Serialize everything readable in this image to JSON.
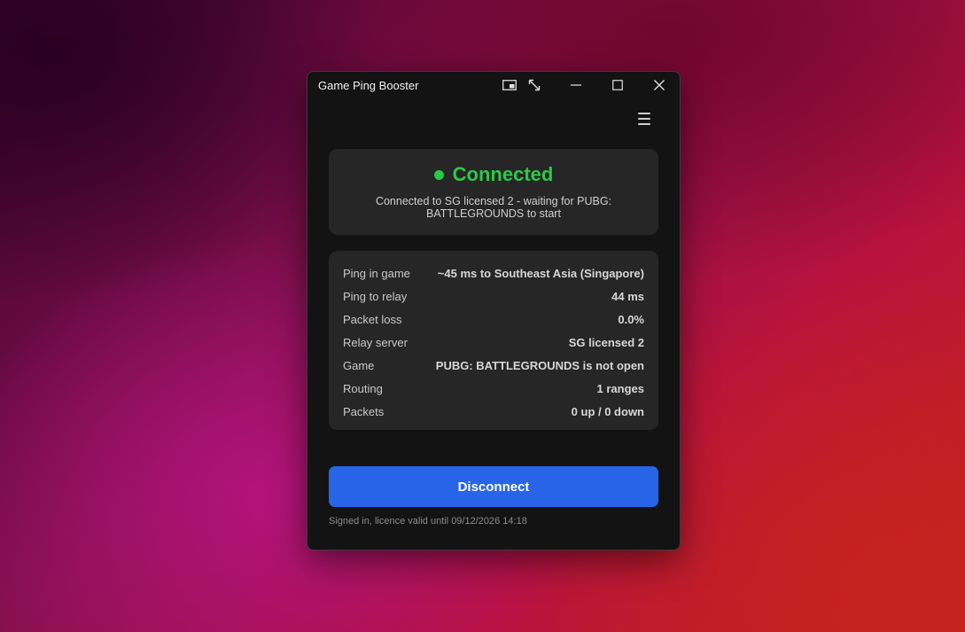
{
  "window": {
    "title": "Game Ping Booster"
  },
  "titlebar_icons": [
    "picture-in-picture-icon",
    "expand-icon",
    "minimize-icon",
    "maximize-icon",
    "close-icon"
  ],
  "status": {
    "title": "Connected",
    "subtitle": "Connected to SG licensed 2 - waiting for PUBG: BATTLEGROUNDS to start",
    "color": "#2ec84a"
  },
  "stats": [
    {
      "label": "Ping in game",
      "value": "~45 ms to Southeast Asia (Singapore)"
    },
    {
      "label": "Ping to relay",
      "value": "44 ms"
    },
    {
      "label": "Packet loss",
      "value": "0.0%"
    },
    {
      "label": "Relay server",
      "value": "SG licensed 2"
    },
    {
      "label": "Game",
      "value": "PUBG: BATTLEGROUNDS is not open"
    },
    {
      "label": "Routing",
      "value": "1 ranges"
    },
    {
      "label": "Packets",
      "value": "0 up / 0 down"
    }
  ],
  "actions": {
    "disconnect_label": "Disconnect",
    "accent": "#2764e8"
  },
  "footer": {
    "licence_text": "Signed in, licence valid until 09/12/2026 14:18"
  }
}
